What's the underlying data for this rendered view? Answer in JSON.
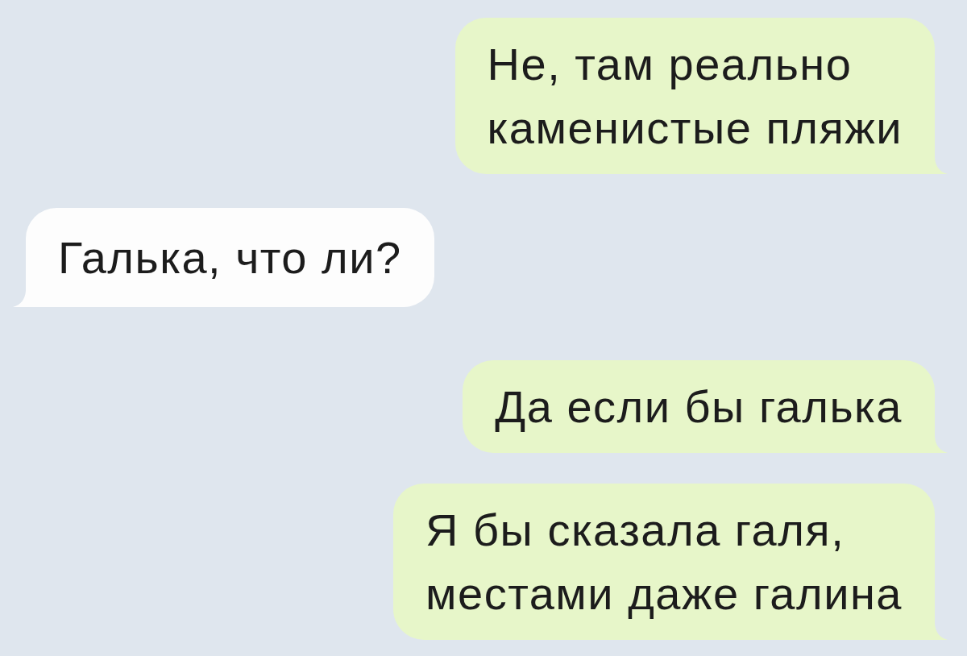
{
  "messages": [
    {
      "kind": "outgoing",
      "text": "Не, там реально\nкаменистые пляжи"
    },
    {
      "kind": "incoming",
      "text": "Галька, что ли?"
    },
    {
      "kind": "outgoing",
      "text": "Да если бы галька"
    },
    {
      "kind": "outgoing",
      "text": "Я бы сказала галя,\nместами даже галина"
    }
  ]
}
